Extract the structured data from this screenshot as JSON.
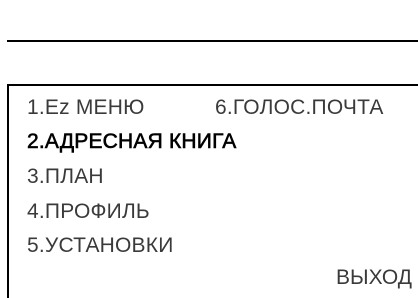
{
  "header": {
    "status_text": "",
    "title": ""
  },
  "menu": {
    "items": [
      {
        "label": "1.Ez МЕНЮ"
      },
      {
        "label": "2.АДРЕСНАЯ КНИГА",
        "selected": true
      },
      {
        "label": "3.ПЛАН"
      },
      {
        "label": "4.ПРОФИЛЬ"
      },
      {
        "label": "5.УСТАНОВКИ"
      },
      {
        "label": "6.ГОЛОС.ПОЧТА"
      }
    ]
  },
  "softkeys": {
    "right_label": "ВЫХОД"
  }
}
